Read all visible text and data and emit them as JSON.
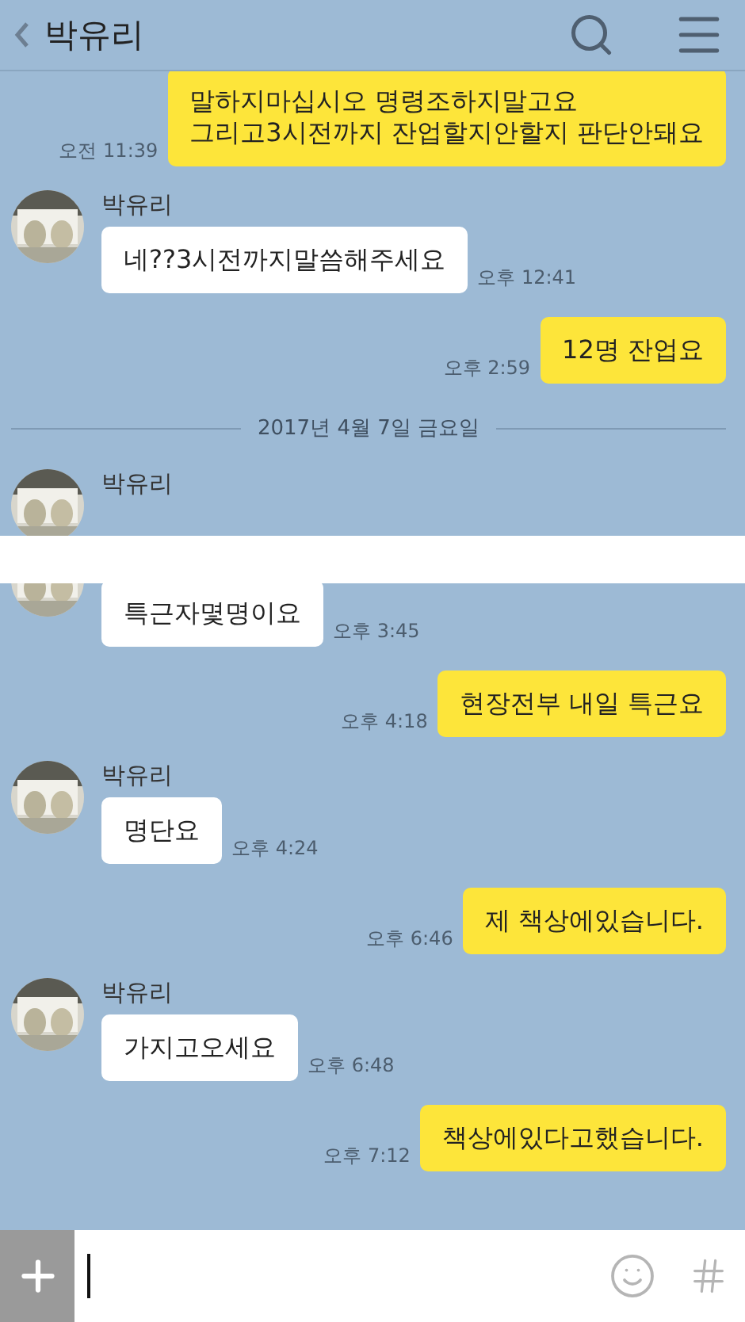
{
  "header": {
    "title": "박유리"
  },
  "panels": [
    {
      "messages": [
        {
          "kind": "sent",
          "text": "말하지마십시오 명령조하지말고요\n그리고3시전까지 잔업할지안할지 판단안돼요",
          "time": "오전 11:39"
        },
        {
          "kind": "received",
          "name": "박유리",
          "text": "네??3시전까지말씀해주세요",
          "time": "오후 12:41"
        },
        {
          "kind": "sent",
          "text": "12명 잔업요",
          "time": "오후 2:59"
        },
        {
          "kind": "date",
          "text": "2017년 4월 7일 금요일"
        },
        {
          "kind": "received",
          "name": "박유리"
        }
      ]
    },
    {
      "messages": [
        {
          "kind": "received",
          "text": "특근자몇명이요",
          "time": "오후 3:45"
        },
        {
          "kind": "sent",
          "text": "현장전부 내일 특근요",
          "time": "오후 4:18"
        },
        {
          "kind": "received",
          "name": "박유리",
          "text": "명단요",
          "time": "오후 4:24"
        },
        {
          "kind": "sent",
          "text": "제 책상에있습니다.",
          "time": "오후 6:46"
        },
        {
          "kind": "received",
          "name": "박유리",
          "text": "가지고오세요",
          "time": "오후 6:48"
        },
        {
          "kind": "sent",
          "text": "책상에있다고했습니다.",
          "time": "오후 7:12"
        }
      ]
    }
  ]
}
